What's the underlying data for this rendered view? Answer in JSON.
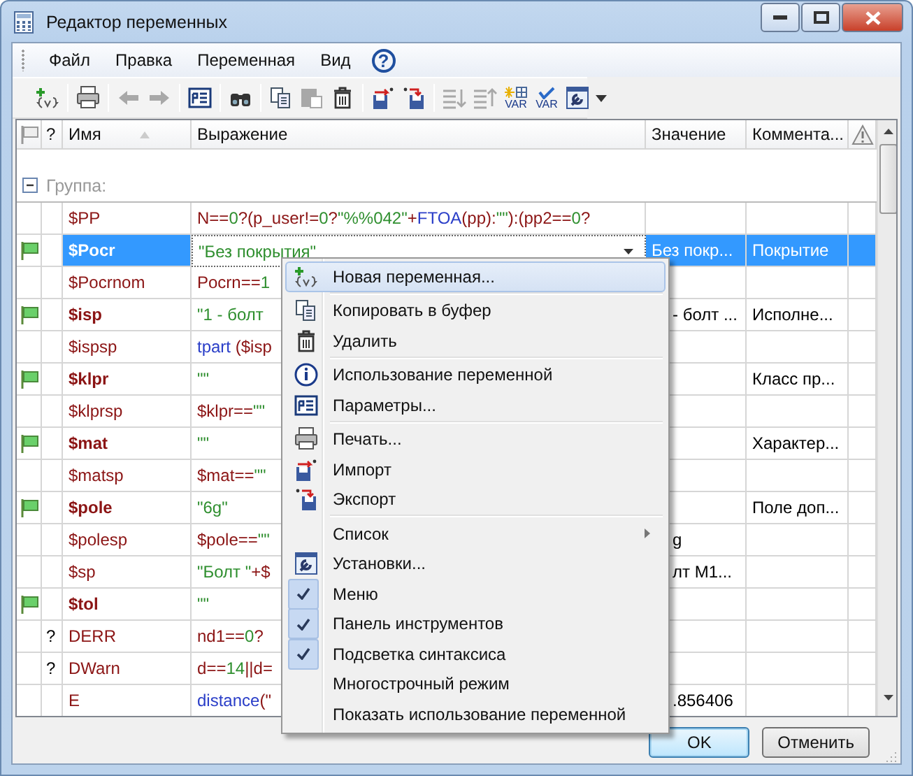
{
  "window": {
    "title": "Редактор переменных"
  },
  "menu_bar": [
    {
      "label": "Файл"
    },
    {
      "label": "Правка"
    },
    {
      "label": "Переменная"
    },
    {
      "label": "Вид"
    },
    {
      "label": "?",
      "kind": "help"
    }
  ],
  "toolbar": [
    {
      "kind": "newvar",
      "disabled": false
    },
    {
      "kind": "sep"
    },
    {
      "kind": "print",
      "disabled": false
    },
    {
      "kind": "sep"
    },
    {
      "kind": "undo",
      "disabled": true
    },
    {
      "kind": "redo",
      "disabled": true
    },
    {
      "kind": "sep"
    },
    {
      "kind": "params",
      "disabled": false
    },
    {
      "kind": "sep"
    },
    {
      "kind": "find",
      "disabled": false
    },
    {
      "kind": "sep"
    },
    {
      "kind": "copy",
      "disabled": false
    },
    {
      "kind": "paste",
      "disabled": true
    },
    {
      "kind": "delete",
      "disabled": false
    },
    {
      "kind": "sep"
    },
    {
      "kind": "import",
      "disabled": false
    },
    {
      "kind": "export",
      "disabled": false
    },
    {
      "kind": "sep"
    },
    {
      "kind": "sortdown",
      "disabled": true
    },
    {
      "kind": "sortup",
      "disabled": true
    },
    {
      "kind": "varnew",
      "label": "VAR",
      "disabled": false
    },
    {
      "kind": "varcheck",
      "label": "VAR",
      "disabled": false
    },
    {
      "kind": "settings",
      "disabled": false
    },
    {
      "kind": "more"
    }
  ],
  "table": {
    "columns": [
      {
        "kind": "flag"
      },
      {
        "kind": "text",
        "label": "?"
      },
      {
        "kind": "text",
        "label": "Имя",
        "sorted": true
      },
      {
        "kind": "text",
        "label": "Выражение"
      },
      {
        "kind": "text",
        "label": "Значение"
      },
      {
        "kind": "text",
        "label": "Коммента..."
      },
      {
        "kind": "warning"
      }
    ],
    "group": {
      "label": "Группа:",
      "expanded": true
    },
    "rows": [
      {
        "name": "$PP",
        "external": false,
        "selected": false,
        "expression": [
          {
            "t": "N",
            "kind": "var"
          },
          {
            "t": "==",
            "kind": "op"
          },
          {
            "t": "0",
            "kind": "num"
          },
          {
            "t": "?(",
            "kind": "op"
          },
          {
            "t": "p_user",
            "kind": "var"
          },
          {
            "t": "!=",
            "kind": "op"
          },
          {
            "t": "0",
            "kind": "num"
          },
          {
            "t": "?",
            "kind": "op"
          },
          {
            "t": "\"%%042\"",
            "kind": "str"
          },
          {
            "t": "+",
            "kind": "op"
          },
          {
            "t": "FTOA",
            "kind": "func"
          },
          {
            "t": "(",
            "kind": "op"
          },
          {
            "t": "pp",
            "kind": "var"
          },
          {
            "t": "):",
            "kind": "op"
          },
          {
            "t": "\"\"",
            "kind": "str"
          },
          {
            "t": "):(",
            "kind": "op"
          },
          {
            "t": "pp2",
            "kind": "var"
          },
          {
            "t": "==",
            "kind": "op"
          },
          {
            "t": "0",
            "kind": "num"
          },
          {
            "t": "?",
            "kind": "op"
          }
        ]
      },
      {
        "name": "$Pocr",
        "external": true,
        "selected": true,
        "expression": [
          {
            "t": "\"Без покрытия\"",
            "kind": "str"
          }
        ],
        "value": "Без покр...",
        "comment": "Покрытие"
      },
      {
        "name": "$Pocrnom",
        "external": false,
        "selected": false,
        "expression": [
          {
            "t": "Pocrn",
            "kind": "var"
          },
          {
            "t": "==",
            "kind": "op"
          },
          {
            "t": "1",
            "kind": "num"
          }
        ]
      },
      {
        "name": "$isp",
        "external": true,
        "selected": false,
        "expression": [
          {
            "t": "\"1 - болт",
            "kind": "str"
          }
        ],
        "value": "- болт ...",
        "comment": "Исполне..."
      },
      {
        "name": "$ispsp",
        "external": false,
        "selected": false,
        "expression": [
          {
            "t": "tpart",
            "kind": "func"
          },
          {
            "t": " (",
            "kind": "op"
          },
          {
            "t": "$isp",
            "kind": "var"
          }
        ]
      },
      {
        "name": "$klpr",
        "external": true,
        "selected": false,
        "expression": [
          {
            "t": "\"\"",
            "kind": "str"
          }
        ],
        "comment": "Класс пр..."
      },
      {
        "name": "$klprsp",
        "external": false,
        "selected": false,
        "expression": [
          {
            "t": "$klpr",
            "kind": "var"
          },
          {
            "t": "==",
            "kind": "op"
          },
          {
            "t": "\"\"",
            "kind": "str"
          }
        ]
      },
      {
        "name": "$mat",
        "external": true,
        "selected": false,
        "expression": [
          {
            "t": "\"\"",
            "kind": "str"
          }
        ],
        "comment": "Характер..."
      },
      {
        "name": "$matsp",
        "external": false,
        "selected": false,
        "expression": [
          {
            "t": "$mat",
            "kind": "var"
          },
          {
            "t": "==",
            "kind": "op"
          },
          {
            "t": "\"\"",
            "kind": "str"
          }
        ]
      },
      {
        "name": "$pole",
        "external": true,
        "selected": false,
        "expression": [
          {
            "t": "\"6g\"",
            "kind": "str"
          }
        ],
        "comment": "Поле доп..."
      },
      {
        "name": "$polesp",
        "external": false,
        "selected": false,
        "expression": [
          {
            "t": "$pole",
            "kind": "var"
          },
          {
            "t": "==",
            "kind": "op"
          },
          {
            "t": "\"\"",
            "kind": "str"
          }
        ],
        "value": "g"
      },
      {
        "name": "$sp",
        "external": false,
        "selected": false,
        "expression": [
          {
            "t": "\"Болт \"",
            "kind": "str"
          },
          {
            "t": "+",
            "kind": "op"
          },
          {
            "t": "$",
            "kind": "var"
          }
        ],
        "value": "лт M1..."
      },
      {
        "name": "$tol",
        "external": true,
        "selected": false,
        "expression": [
          {
            "t": "\"\"",
            "kind": "str"
          }
        ]
      },
      {
        "name": "DERR",
        "status": "?",
        "external": false,
        "selected": false,
        "expression": [
          {
            "t": "nd1",
            "kind": "var"
          },
          {
            "t": "==",
            "kind": "op"
          },
          {
            "t": "0",
            "kind": "num"
          },
          {
            "t": "?",
            "kind": "op"
          }
        ]
      },
      {
        "name": "DWarn",
        "status": "?",
        "external": false,
        "selected": false,
        "expression": [
          {
            "t": "d",
            "kind": "var"
          },
          {
            "t": "==",
            "kind": "op"
          },
          {
            "t": "14",
            "kind": "num"
          },
          {
            "t": "||",
            "kind": "op"
          },
          {
            "t": "d",
            "kind": "var"
          },
          {
            "t": "=",
            "kind": "op"
          }
        ]
      },
      {
        "name": "E",
        "external": false,
        "selected": false,
        "expression": [
          {
            "t": "distance",
            "kind": "func"
          },
          {
            "t": "(\"",
            "kind": "op"
          }
        ],
        "value": ".856406"
      }
    ]
  },
  "context_menu": [
    {
      "kind": "newvar",
      "label": "Новая переменная...",
      "selected": true
    },
    {
      "kind": "sep"
    },
    {
      "kind": "copy",
      "label": "Копировать в буфер",
      "selected": false
    },
    {
      "kind": "delete",
      "label": "Удалить",
      "selected": false
    },
    {
      "kind": "sep"
    },
    {
      "kind": "info",
      "label": "Использование переменной",
      "selected": false
    },
    {
      "kind": "params",
      "label": "Параметры...",
      "selected": false
    },
    {
      "kind": "sep"
    },
    {
      "kind": "print",
      "label": "Печать...",
      "selected": false
    },
    {
      "kind": "import",
      "label": "Импорт",
      "selected": false
    },
    {
      "kind": "export",
      "label": "Экспорт",
      "selected": false
    },
    {
      "kind": "sep"
    },
    {
      "kind": "submenu",
      "label": "Список",
      "selected": false
    },
    {
      "kind": "settings",
      "label": "Установки...",
      "selected": false
    },
    {
      "kind": "check",
      "label": "Меню",
      "checked": true,
      "selected": false
    },
    {
      "kind": "check",
      "label": "Панель инструментов",
      "checked": true,
      "selected": false
    },
    {
      "kind": "check",
      "label": "Подсветка синтаксиса",
      "checked": true,
      "selected": false
    },
    {
      "kind": "check",
      "label": "Многострочный режим",
      "checked": false,
      "selected": false
    },
    {
      "kind": "check",
      "label": "Показать использование переменной",
      "checked": false,
      "selected": false
    }
  ],
  "buttons": [
    {
      "label": "OK",
      "default": true
    },
    {
      "label": "Отменить",
      "default": false
    }
  ]
}
